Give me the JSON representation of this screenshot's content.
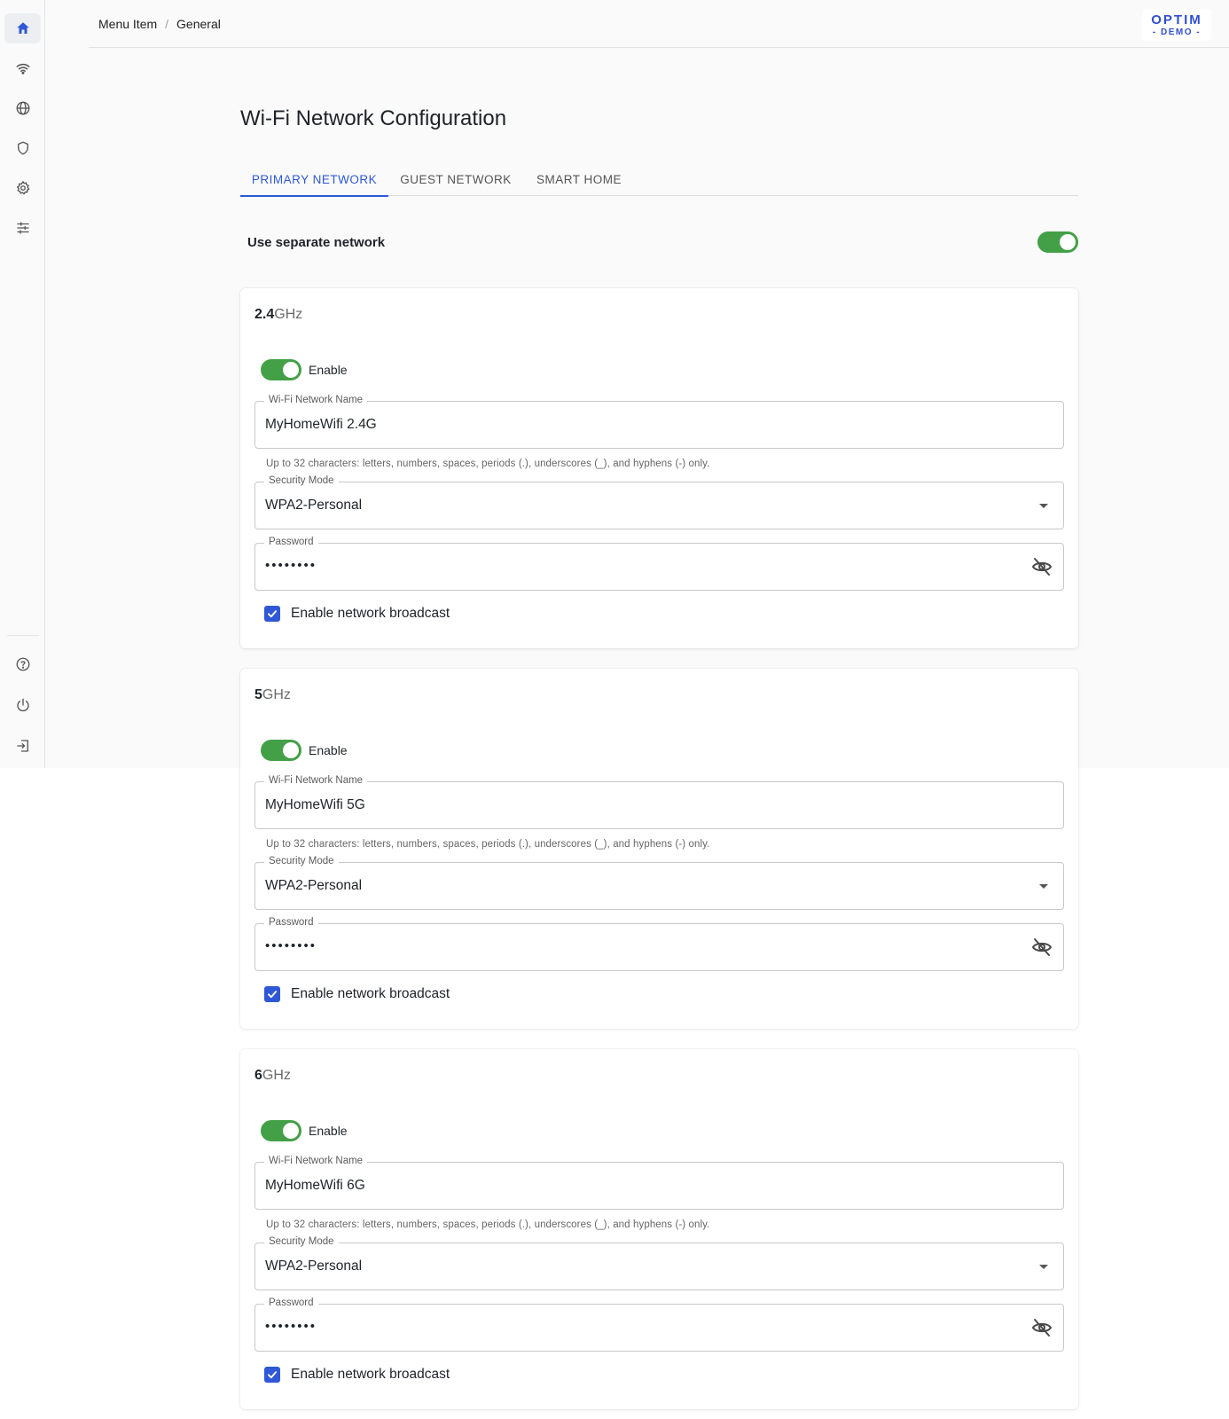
{
  "sidebar": {
    "items": [
      {
        "icon": "home-icon",
        "active": true
      },
      {
        "icon": "wifi-icon",
        "active": false
      },
      {
        "icon": "globe-icon",
        "active": false
      },
      {
        "icon": "shield-icon",
        "active": false
      },
      {
        "icon": "gear-icon",
        "active": false
      },
      {
        "icon": "sliders-icon",
        "active": false
      }
    ],
    "bottom_items": [
      {
        "icon": "help-icon"
      },
      {
        "icon": "power-icon"
      },
      {
        "icon": "logout-icon"
      }
    ]
  },
  "header": {
    "breadcrumb": [
      "Menu Item",
      "General"
    ],
    "breadcrumb_separator": "/",
    "logo_main": "OPTIM",
    "logo_sub": "- DEMO -"
  },
  "page": {
    "title": "Wi-Fi Network Configuration",
    "tabs": [
      {
        "label": "PRIMARY NETWORK",
        "active": true
      },
      {
        "label": "GUEST NETWORK",
        "active": false
      },
      {
        "label": "SMART HOME",
        "active": false
      }
    ],
    "separate_network": {
      "label": "Use separate network",
      "enabled": true
    }
  },
  "bands": [
    {
      "title_bold": "2.4",
      "title_unit": "GHz",
      "enable_label": "Enable",
      "enabled": true,
      "ssid_label": "Wi-Fi Network Name",
      "ssid_value": "MyHomeWifi 2.4G",
      "helper": "Up to 32 characters: letters, numbers, spaces, periods (.), underscores (_), and hyphens (-) only.",
      "security_label": "Security Mode",
      "security_value": "WPA2-Personal",
      "password_label": "Password",
      "password_value": "••••••••",
      "broadcast_label": "Enable network broadcast",
      "broadcast_checked": true
    },
    {
      "title_bold": "5",
      "title_unit": "GHz",
      "enable_label": "Enable",
      "enabled": true,
      "ssid_label": "Wi-Fi Network Name",
      "ssid_value": "MyHomeWifi 5G",
      "helper": "Up to 32 characters: letters, numbers, spaces, periods (.), underscores (_), and hyphens (-) only.",
      "security_label": "Security Mode",
      "security_value": "WPA2-Personal",
      "password_label": "Password",
      "password_value": "••••••••",
      "broadcast_label": "Enable network broadcast",
      "broadcast_checked": true
    },
    {
      "title_bold": "6",
      "title_unit": "GHz",
      "enable_label": "Enable",
      "enabled": true,
      "ssid_label": "Wi-Fi Network Name",
      "ssid_value": "MyHomeWifi 6G",
      "helper": "Up to 32 characters: letters, numbers, spaces, periods (.), underscores (_), and hyphens (-) only.",
      "security_label": "Security Mode",
      "security_value": "WPA2-Personal",
      "password_label": "Password",
      "password_value": "••••••••",
      "broadcast_label": "Enable network broadcast",
      "broadcast_checked": true
    }
  ],
  "colors": {
    "accent": "#2f58d6",
    "toggle_on": "#43a047",
    "logo": "#2f4fcf"
  }
}
